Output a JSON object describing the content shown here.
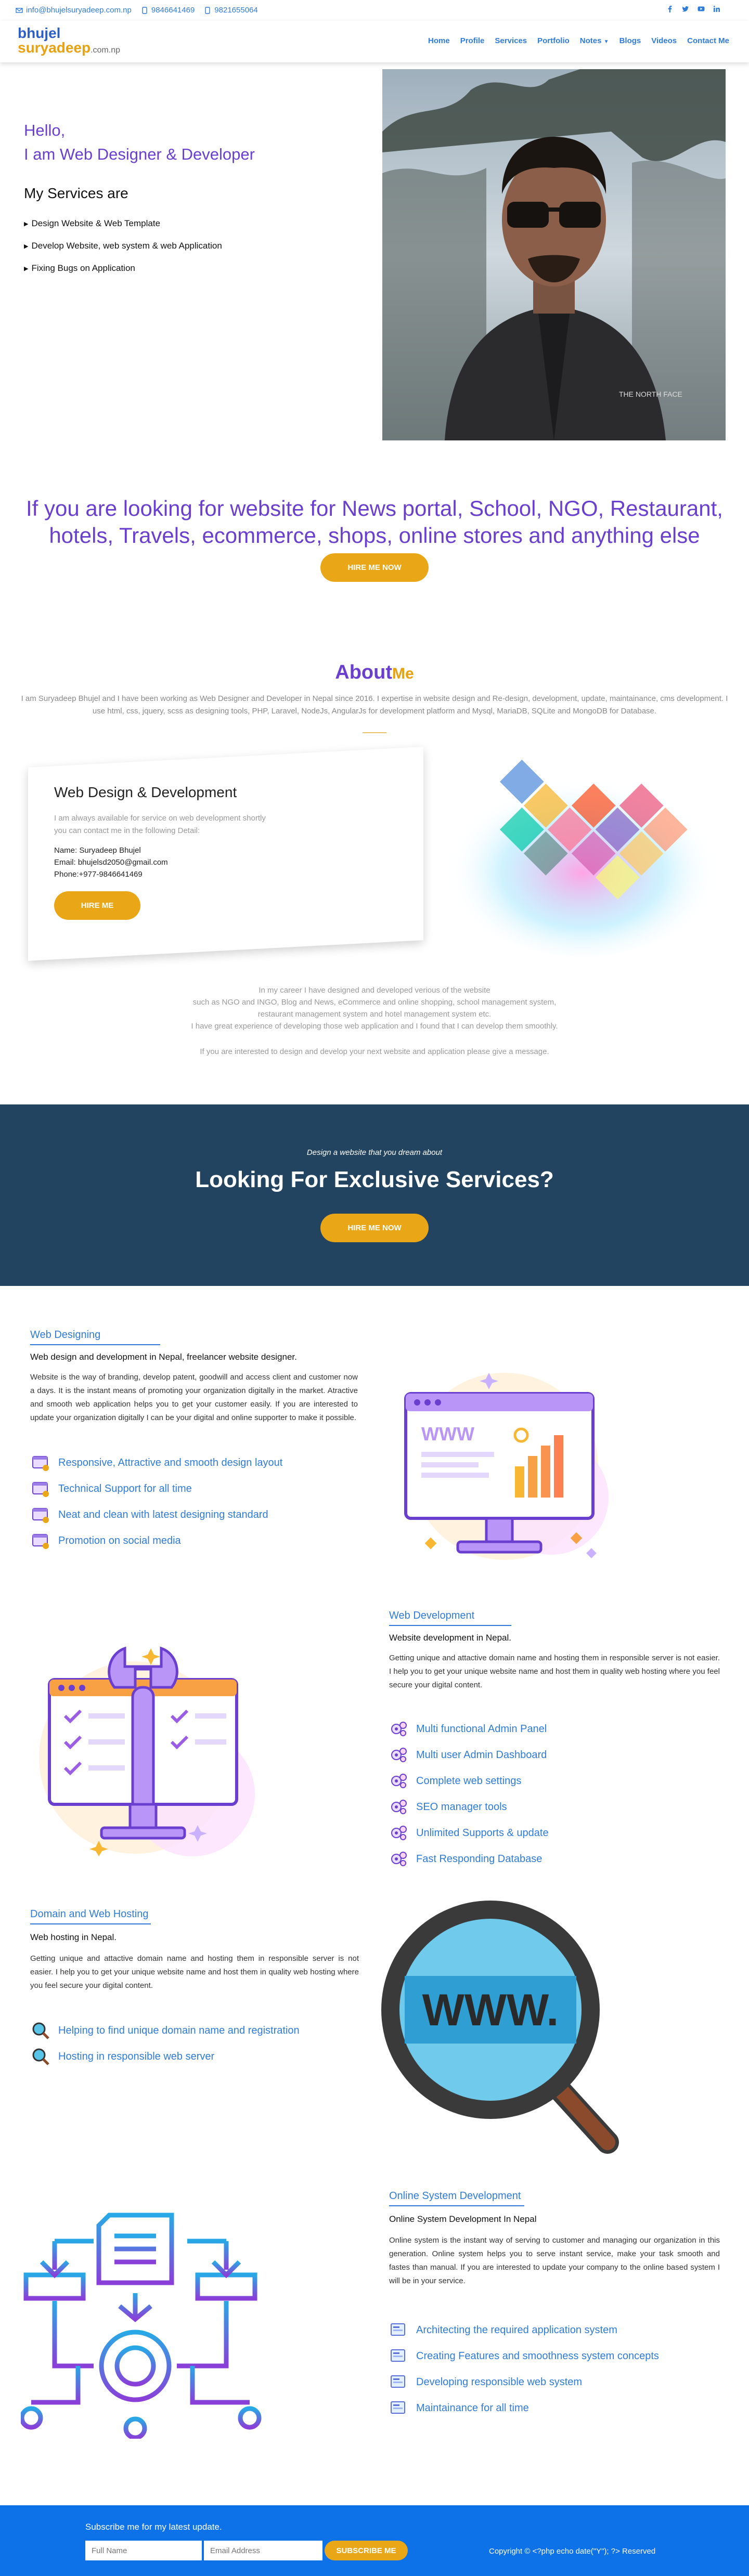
{
  "topbar": {
    "email": "info@bhujelsuryadeep.com.np",
    "phone1": "9846641469",
    "phone2": "9821655064",
    "social": [
      "facebook-icon",
      "twitter-icon",
      "youtube-icon",
      "linkedin-icon"
    ]
  },
  "header": {
    "logo_line1": "bhujel",
    "logo_line2": "suryadeep",
    "logo_suffix": ".com.np",
    "nav": [
      "Home",
      "Profile",
      "Services",
      "Portfolio",
      "Notes",
      "Blogs",
      "Videos",
      "Contact Me"
    ]
  },
  "hero": {
    "hello": "Hello,",
    "role": "I am Web Designer & Developer",
    "services_heading": "My Services are",
    "services": [
      "Design Website & Web Template",
      "Develop Website, web system & web Application",
      "Fixing Bugs on Application"
    ]
  },
  "tagline": {
    "text": "If you are looking for website for News portal, School, NGO, Restaurant, hotels, Travels, ecommerce, shops, online stores and anything else",
    "button": "HIRE ME NOW"
  },
  "about": {
    "title": "About",
    "title_me": "Me",
    "text": "I am Suryadeep Bhujel and I have been working as Web Designer and Developer in Nepal since 2016. I expertise in website design and Re-design, development, update, maintainance, cms development. I use html, css, jquery, scss as designing tools, PHP, Laravel, NodeJs, AngularJs for development platform and Mysql, MariaDB, SQLite and MongoDB for Database."
  },
  "card": {
    "title": "Web Design & Development",
    "sub": "I am always available for service on web development shortly you can contact me in the following Detail:",
    "name": "Name: Suryadeep Bhujel",
    "email": "Email: bhujelsd2050@gmail.com",
    "phone": "Phone:+977-9846641469",
    "button": "HIRE ME"
  },
  "career": {
    "line1": "In my career I have designed and developed verious of the website",
    "line2": "such as NGO and INGO, Blog and News, eCommerce and online shopping, school management system,",
    "line3": "restaurant management system and hotel management system etc.",
    "line4": "I have great experience of developing those web application and I found that I can develop them smoothly.",
    "line5": "If you are interested to design and develop your next website and application please give a message."
  },
  "banner": {
    "small": "Design a website that you dream about",
    "big": "Looking For Exclusive Services?",
    "button": "HIRE ME NOW"
  },
  "web_designing": {
    "title": "Web Designing",
    "sub": "Web design and development in Nepal, freelancer website designer.",
    "body": "Website is the way of branding, develop patent, goodwill and access client and customer now a days. It is the instant means of promoting your organization digitally in the market. Atractive and smooth web application helps you to get your customer easily. If you are interested to update your organization digitally I can be your digital and online supporter to make it possible.",
    "features": [
      "Responsive, Attractive and smooth design layout",
      "Technical Support for all time",
      "Neat and clean with latest designing standard",
      "Promotion on social media"
    ]
  },
  "web_development": {
    "title": "Web Development",
    "sub": "Website development in Nepal.",
    "body": "Getting unique and attactive domain name and hosting them in responsible server is not easier. I help you to get your unique website name and host them in quality web hosting where you feel secure your digital content.",
    "features": [
      "Multi functional Admin Panel",
      "Multi user Admin Dashboard",
      "Complete web settings",
      "SEO manager tools",
      "Unlimited Supports & update",
      "Fast Responding Database"
    ]
  },
  "hosting": {
    "title": "Domain and Web Hosting",
    "sub": "Web hosting in Nepal.",
    "body": "Getting unique and attactive domain name and hosting them in responsible server is not easier. I help you to get your unique website name and host them in quality web hosting where you feel secure your digital content.",
    "features": [
      "Helping to find unique domain name and registration",
      "Hosting in responsible web server"
    ],
    "www": "WWW."
  },
  "online_system": {
    "title": "Online System Development",
    "sub": "Online System Development In Nepal",
    "body": "Online system is the instant way of serving to customer and managing our organization in this generation. Online system helps you to serve instant service, make your task smooth and fastes than manual. If you are interested to update your company to the online based system I will be in your service.",
    "features": [
      "Architecting the required application system",
      "Creating Features and smoothness system concepts",
      "Developing responsible web system",
      "Maintainance for all time"
    ]
  },
  "footer": {
    "subscribe_text": "Subscribe me for my latest update.",
    "fullname_placeholder": "Full Name",
    "email_placeholder": "Email Address",
    "button": "SUBSCRIBE ME",
    "copyright": "Copyright © <?php echo date(\"Y\"); ?> Reserved"
  },
  "colors": {
    "primary": "#2f7bd8",
    "purple": "#6a3fd0",
    "accent": "#e9a616",
    "banner": "#234460",
    "footer": "#0d72e8"
  }
}
